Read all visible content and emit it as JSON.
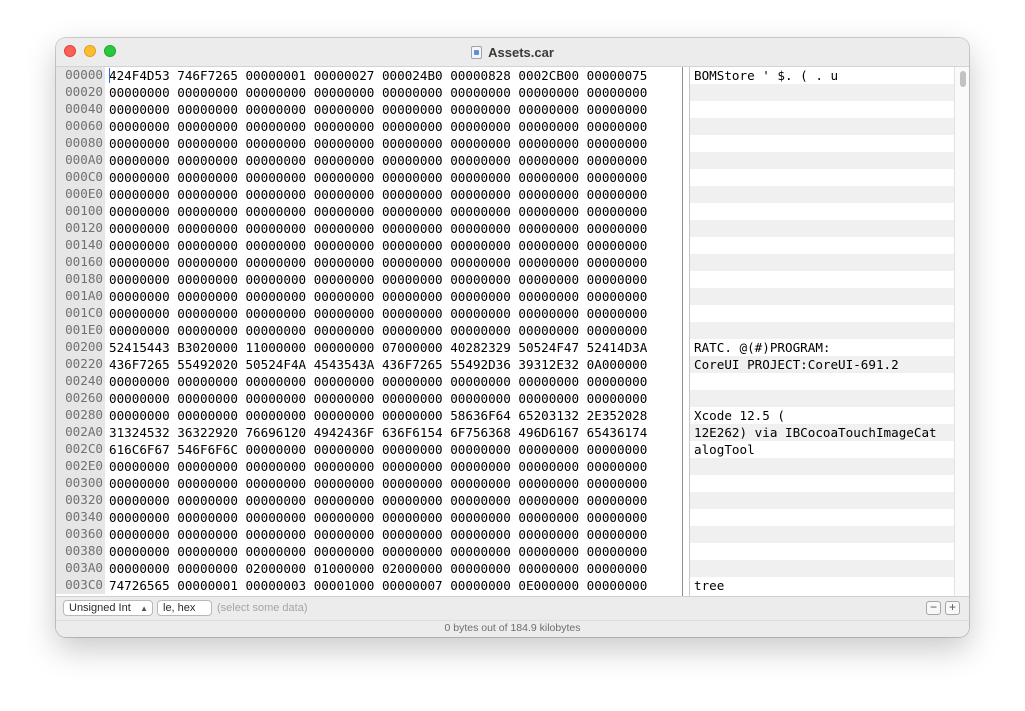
{
  "window": {
    "title": "Assets.car"
  },
  "hexview": {
    "rows": [
      {
        "offset": "00000",
        "hex": "424F4D53 746F7265 00000001 00000027 000024B0 00000828 0002CB00 00000075",
        "ascii": "BOMStore       '  $.   (  .    u"
      },
      {
        "offset": "00020",
        "hex": "00000000 00000000 00000000 00000000 00000000 00000000 00000000 00000000",
        "ascii": ""
      },
      {
        "offset": "00040",
        "hex": "00000000 00000000 00000000 00000000 00000000 00000000 00000000 00000000",
        "ascii": ""
      },
      {
        "offset": "00060",
        "hex": "00000000 00000000 00000000 00000000 00000000 00000000 00000000 00000000",
        "ascii": ""
      },
      {
        "offset": "00080",
        "hex": "00000000 00000000 00000000 00000000 00000000 00000000 00000000 00000000",
        "ascii": ""
      },
      {
        "offset": "000A0",
        "hex": "00000000 00000000 00000000 00000000 00000000 00000000 00000000 00000000",
        "ascii": ""
      },
      {
        "offset": "000C0",
        "hex": "00000000 00000000 00000000 00000000 00000000 00000000 00000000 00000000",
        "ascii": ""
      },
      {
        "offset": "000E0",
        "hex": "00000000 00000000 00000000 00000000 00000000 00000000 00000000 00000000",
        "ascii": ""
      },
      {
        "offset": "00100",
        "hex": "00000000 00000000 00000000 00000000 00000000 00000000 00000000 00000000",
        "ascii": ""
      },
      {
        "offset": "00120",
        "hex": "00000000 00000000 00000000 00000000 00000000 00000000 00000000 00000000",
        "ascii": ""
      },
      {
        "offset": "00140",
        "hex": "00000000 00000000 00000000 00000000 00000000 00000000 00000000 00000000",
        "ascii": ""
      },
      {
        "offset": "00160",
        "hex": "00000000 00000000 00000000 00000000 00000000 00000000 00000000 00000000",
        "ascii": ""
      },
      {
        "offset": "00180",
        "hex": "00000000 00000000 00000000 00000000 00000000 00000000 00000000 00000000",
        "ascii": ""
      },
      {
        "offset": "001A0",
        "hex": "00000000 00000000 00000000 00000000 00000000 00000000 00000000 00000000",
        "ascii": ""
      },
      {
        "offset": "001C0",
        "hex": "00000000 00000000 00000000 00000000 00000000 00000000 00000000 00000000",
        "ascii": ""
      },
      {
        "offset": "001E0",
        "hex": "00000000 00000000 00000000 00000000 00000000 00000000 00000000 00000000",
        "ascii": ""
      },
      {
        "offset": "00200",
        "hex": "52415443 B3020000 11000000 00000000 07000000 40282329 50524F47 52414D3A",
        "ascii": "RATC.            @(#)PROGRAM:"
      },
      {
        "offset": "00220",
        "hex": "436F7265 55492020 50524F4A 4543543A 436F7265 55492D36 39312E32 0A000000",
        "ascii": "CoreUI  PROJECT:CoreUI-691.2"
      },
      {
        "offset": "00240",
        "hex": "00000000 00000000 00000000 00000000 00000000 00000000 00000000 00000000",
        "ascii": ""
      },
      {
        "offset": "00260",
        "hex": "00000000 00000000 00000000 00000000 00000000 00000000 00000000 00000000",
        "ascii": ""
      },
      {
        "offset": "00280",
        "hex": "00000000 00000000 00000000 00000000 00000000 58636F64 65203132 2E352028",
        "ascii": "                     Xcode 12.5 ("
      },
      {
        "offset": "002A0",
        "hex": "31324532 36322920 76696120 4942436F 636F6154 6F756368 496D6167 65436174",
        "ascii": "12E262) via IBCocoaTouchImageCat"
      },
      {
        "offset": "002C0",
        "hex": "616C6F67 546F6F6C 00000000 00000000 00000000 00000000 00000000 00000000",
        "ascii": "alogTool"
      },
      {
        "offset": "002E0",
        "hex": "00000000 00000000 00000000 00000000 00000000 00000000 00000000 00000000",
        "ascii": ""
      },
      {
        "offset": "00300",
        "hex": "00000000 00000000 00000000 00000000 00000000 00000000 00000000 00000000",
        "ascii": ""
      },
      {
        "offset": "00320",
        "hex": "00000000 00000000 00000000 00000000 00000000 00000000 00000000 00000000",
        "ascii": ""
      },
      {
        "offset": "00340",
        "hex": "00000000 00000000 00000000 00000000 00000000 00000000 00000000 00000000",
        "ascii": ""
      },
      {
        "offset": "00360",
        "hex": "00000000 00000000 00000000 00000000 00000000 00000000 00000000 00000000",
        "ascii": ""
      },
      {
        "offset": "00380",
        "hex": "00000000 00000000 00000000 00000000 00000000 00000000 00000000 00000000",
        "ascii": ""
      },
      {
        "offset": "003A0",
        "hex": "00000000 00000000 02000000 01000000 02000000 00000000 00000000 00000000",
        "ascii": ""
      },
      {
        "offset": "003C0",
        "hex": "74726565 00000001 00000003 00001000 00000007 00000000 0E000000 00000000",
        "ascii": "tree"
      }
    ]
  },
  "bottombar": {
    "type_label": "Unsigned Int",
    "endian_label": "le, hex",
    "placeholder": "(select some data)",
    "minus_label": "−",
    "plus_label": "+"
  },
  "status": {
    "text": "0 bytes out of 184.9 kilobytes"
  },
  "colors": {
    "close": "#fe5f57",
    "minimize": "#febc2e",
    "zoom": "#28c840",
    "cursor": "#2f6bd8"
  }
}
